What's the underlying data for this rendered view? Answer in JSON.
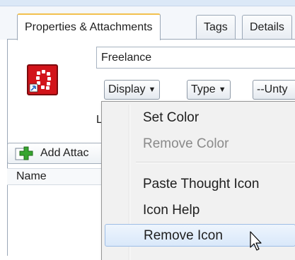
{
  "tabs": [
    {
      "label": "Properties & Attachments",
      "active": true
    },
    {
      "label": "Tags",
      "active": false
    },
    {
      "label": "Details",
      "active": false
    }
  ],
  "properties": {
    "name_value": "Freelance",
    "display_dropdown": "Display",
    "type_dropdown": "Type",
    "untyped_dropdown": "--Unty",
    "partial_label": "L",
    "thought_icon": "thought-icon"
  },
  "attachments": {
    "add_button_label": "Add Attac",
    "column_name": "Name"
  },
  "context_menu": {
    "items": [
      {
        "label": "Set Color",
        "disabled": false
      },
      {
        "label": "Remove Color",
        "disabled": true
      },
      {
        "label": "Paste Thought Icon",
        "disabled": false
      },
      {
        "label": "Icon Help",
        "disabled": false
      },
      {
        "label": "Remove Icon",
        "disabled": false,
        "hovered": true
      }
    ]
  },
  "colors": {
    "accent_tab": "#f2c14e",
    "icon_red": "#d2141a",
    "menu_highlight": "#d9e8fa"
  }
}
